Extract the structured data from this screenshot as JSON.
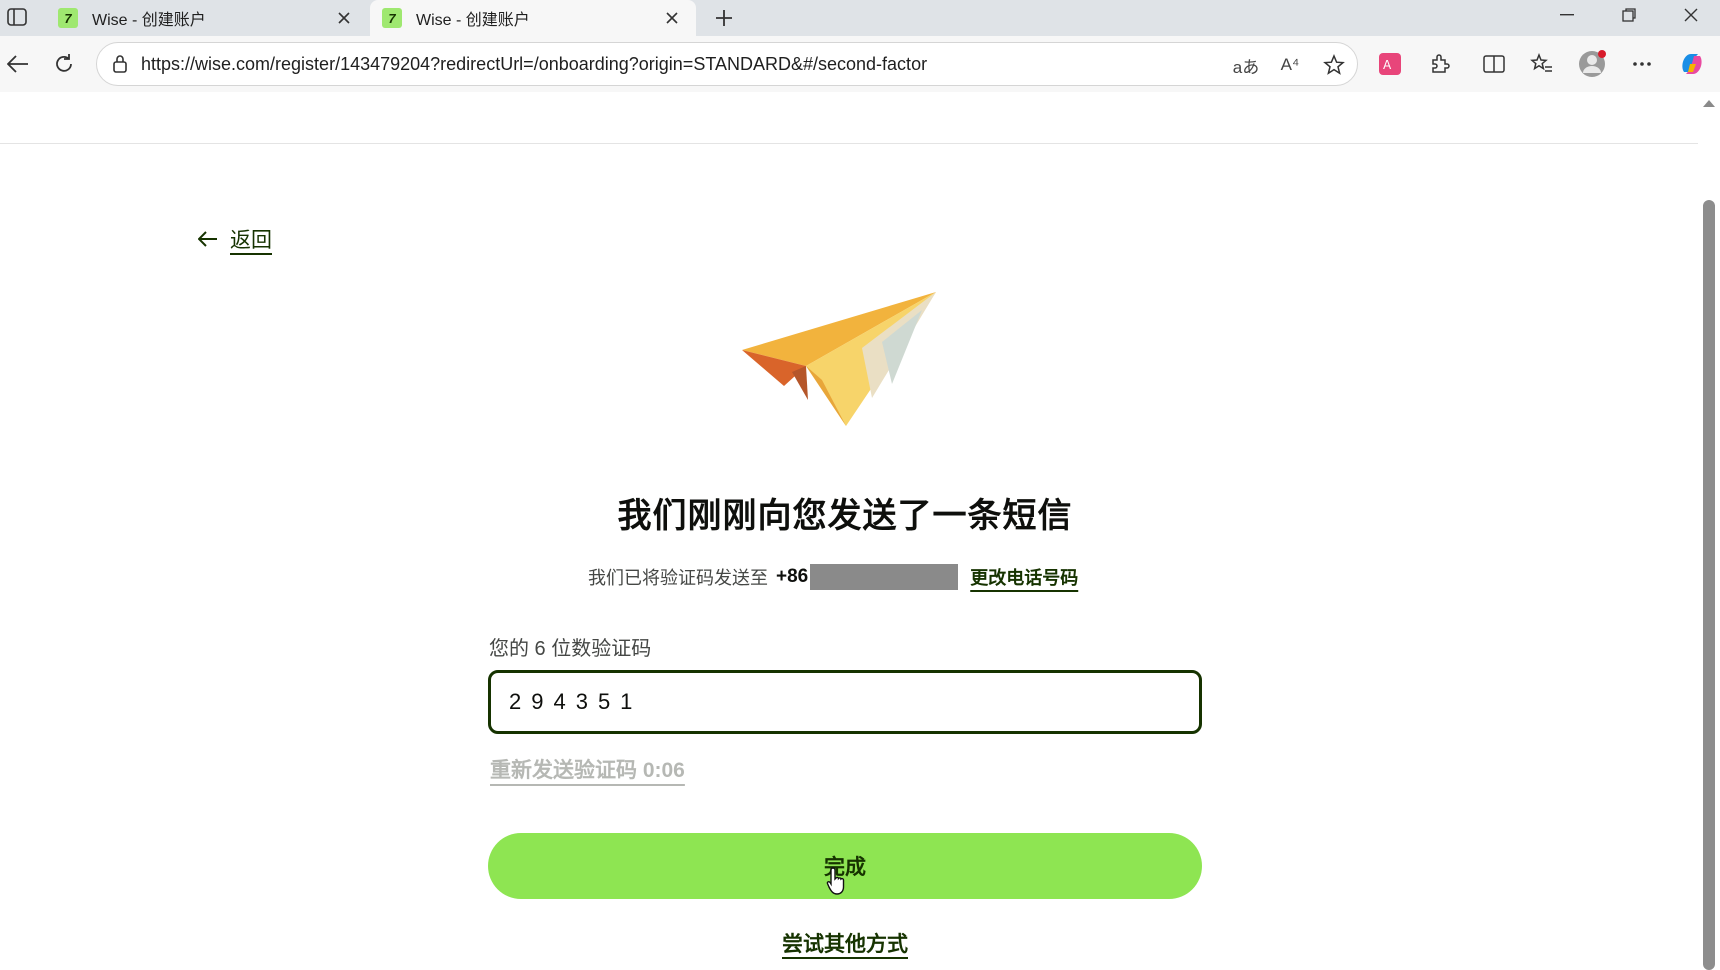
{
  "browser": {
    "tabs": [
      {
        "title": "Wise - 创建账户",
        "favicon": "wise-favicon",
        "active": false
      },
      {
        "title": "Wise - 创建账户",
        "favicon": "wise-favicon",
        "active": true
      }
    ],
    "url": "https://wise.com/register/143479204?redirectUrl=/onboarding?origin=STANDARD&#/second-factor",
    "read_aloud_glyph": "A⁴",
    "translate_glyph": "aあ"
  },
  "page": {
    "back_label": "返回",
    "heading": "我们刚刚向您发送了一条短信",
    "sent_prefix": "我们已将验证码发送至",
    "phone_prefix": "+86",
    "change_phone_label": "更改电话号码",
    "code_label": "您的 6 位数验证码",
    "code_value": "294351",
    "resend_label": "重新发送验证码 0:06",
    "done_label": "完成",
    "other_method_label": "尝试其他方式"
  },
  "colors": {
    "brand_green": "#8ee552",
    "forest_green": "#163300"
  }
}
